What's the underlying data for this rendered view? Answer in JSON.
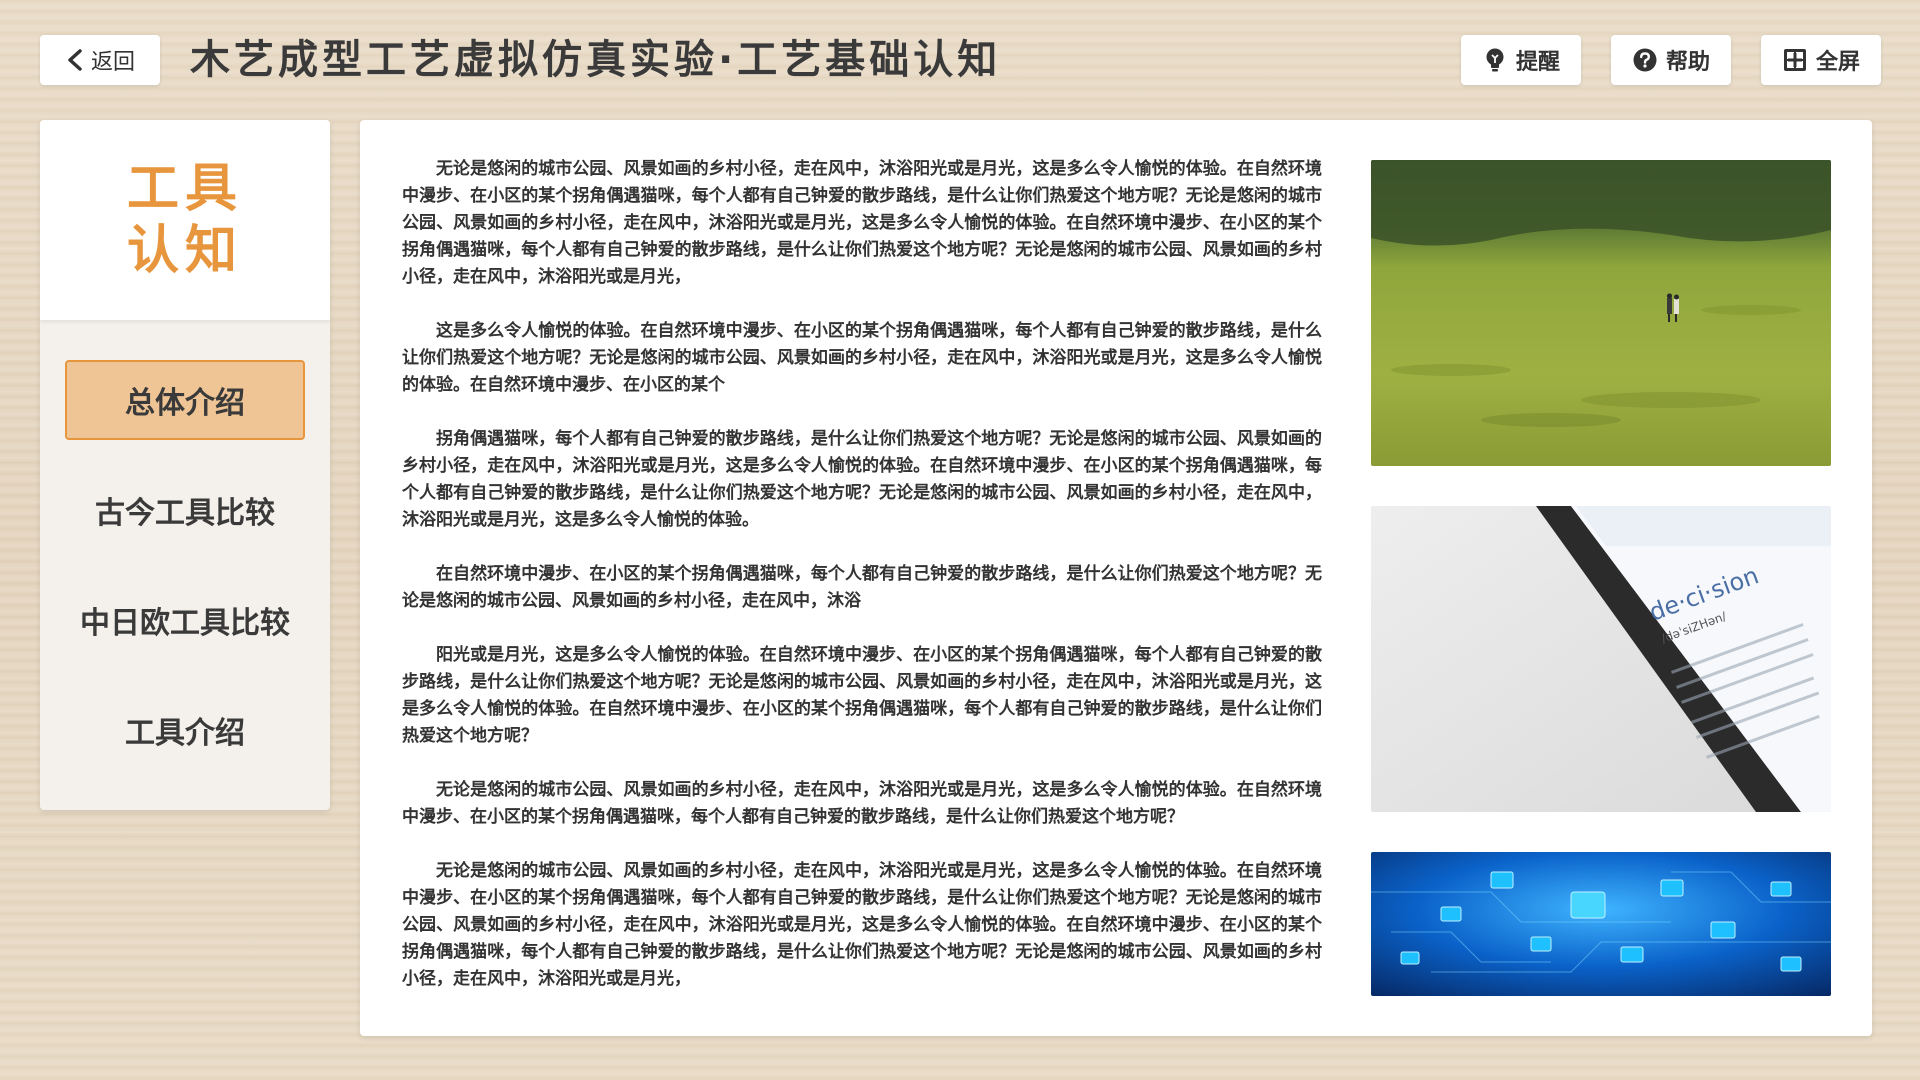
{
  "header": {
    "back_label": "返回",
    "title": "木艺成型工艺虚拟仿真实验·工艺基础认知",
    "buttons": {
      "hint": "提醒",
      "help": "帮助",
      "fullscreen": "全屏"
    }
  },
  "sidebar": {
    "heading_line1": "工具",
    "heading_line2": "认知",
    "items": [
      {
        "label": "总体介绍",
        "active": true
      },
      {
        "label": "古今工具比较",
        "active": false
      },
      {
        "label": "中日欧工具比较",
        "active": false
      },
      {
        "label": "工具介绍",
        "active": false
      }
    ]
  },
  "main": {
    "paragraphs": [
      "无论是悠闲的城市公园、风景如画的乡村小径，走在风中，沐浴阳光或是月光，这是多么令人愉悦的体验。在自然环境中漫步、在小区的某个拐角偶遇猫咪，每个人都有自己钟爱的散步路线，是什么让你们热爱这个地方呢？无论是悠闲的城市公园、风景如画的乡村小径，走在风中，沐浴阳光或是月光，这是多么令人愉悦的体验。在自然环境中漫步、在小区的某个拐角偶遇猫咪，每个人都有自己钟爱的散步路线，是什么让你们热爱这个地方呢？无论是悠闲的城市公园、风景如画的乡村小径，走在风中，沐浴阳光或是月光，",
      "这是多么令人愉悦的体验。在自然环境中漫步、在小区的某个拐角偶遇猫咪，每个人都有自己钟爱的散步路线，是什么让你们热爱这个地方呢？无论是悠闲的城市公园、风景如画的乡村小径，走在风中，沐浴阳光或是月光，这是多么令人愉悦的体验。在自然环境中漫步、在小区的某个",
      "拐角偶遇猫咪，每个人都有自己钟爱的散步路线，是什么让你们热爱这个地方呢？无论是悠闲的城市公园、风景如画的乡村小径，走在风中，沐浴阳光或是月光，这是多么令人愉悦的体验。在自然环境中漫步、在小区的某个拐角偶遇猫咪，每个人都有自己钟爱的散步路线，是什么让你们热爱这个地方呢？无论是悠闲的城市公园、风景如画的乡村小径，走在风中，沐浴阳光或是月光，这是多么令人愉悦的体验。",
      "在自然环境中漫步、在小区的某个拐角偶遇猫咪，每个人都有自己钟爱的散步路线，是什么让你们热爱这个地方呢？无论是悠闲的城市公园、风景如画的乡村小径，走在风中，沐浴",
      "阳光或是月光，这是多么令人愉悦的体验。在自然环境中漫步、在小区的某个拐角偶遇猫咪，每个人都有自己钟爱的散步路线，是什么让你们热爱这个地方呢？无论是悠闲的城市公园、风景如画的乡村小径，走在风中，沐浴阳光或是月光，这是多么令人愉悦的体验。在自然环境中漫步、在小区的某个拐角偶遇猫咪，每个人都有自己钟爱的散步路线，是什么让你们热爱这个地方呢？",
      "无论是悠闲的城市公园、风景如画的乡村小径，走在风中，沐浴阳光或是月光，这是多么令人愉悦的体验。在自然环境中漫步、在小区的某个拐角偶遇猫咪，每个人都有自己钟爱的散步路线，是什么让你们热爱这个地方呢？",
      "无论是悠闲的城市公园、风景如画的乡村小径，走在风中，沐浴阳光或是月光，这是多么令人愉悦的体验。在自然环境中漫步、在小区的某个拐角偶遇猫咪，每个人都有自己钟爱的散步路线，是什么让你们热爱这个地方呢？无论是悠闲的城市公园、风景如画的乡村小径，走在风中，沐浴阳光或是月光，这是多么令人愉悦的体验。在自然环境中漫步、在小区的某个拐角偶遇猫咪，每个人都有自己钟爱的散步路线，是什么让你们热爱这个地方呢？无论是悠闲的城市公园、风景如画的乡村小径，走在风中，沐浴阳光或是月光，"
    ],
    "phone_image_text": {
      "word": "de·ci·sion",
      "phonetic": "/dəˈsiZHən/"
    }
  },
  "colors": {
    "accent": "#e8963e",
    "active_bg": "#f0c596"
  },
  "icons": [
    "back-arrow-icon",
    "lightbulb-icon",
    "question-icon",
    "fullscreen-icon"
  ]
}
